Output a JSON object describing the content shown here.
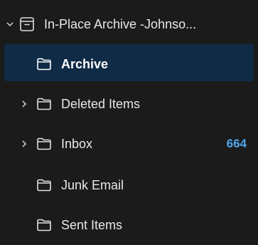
{
  "mailbox": {
    "title": "In-Place Archive -Johnso...",
    "expanded": true,
    "icon": "archive-box-icon"
  },
  "folders": [
    {
      "label": "Archive",
      "selected": true,
      "expandable": false,
      "count": ""
    },
    {
      "label": "Deleted Items",
      "selected": false,
      "expandable": true,
      "count": ""
    },
    {
      "label": "Inbox",
      "selected": false,
      "expandable": true,
      "count": "664"
    },
    {
      "label": "Junk Email",
      "selected": false,
      "expandable": false,
      "count": ""
    },
    {
      "label": "Sent Items",
      "selected": false,
      "expandable": false,
      "count": ""
    }
  ],
  "colors": {
    "background": "#1b1b1b",
    "selected_background": "#0f2b45",
    "count_color": "#4ea6ea"
  }
}
